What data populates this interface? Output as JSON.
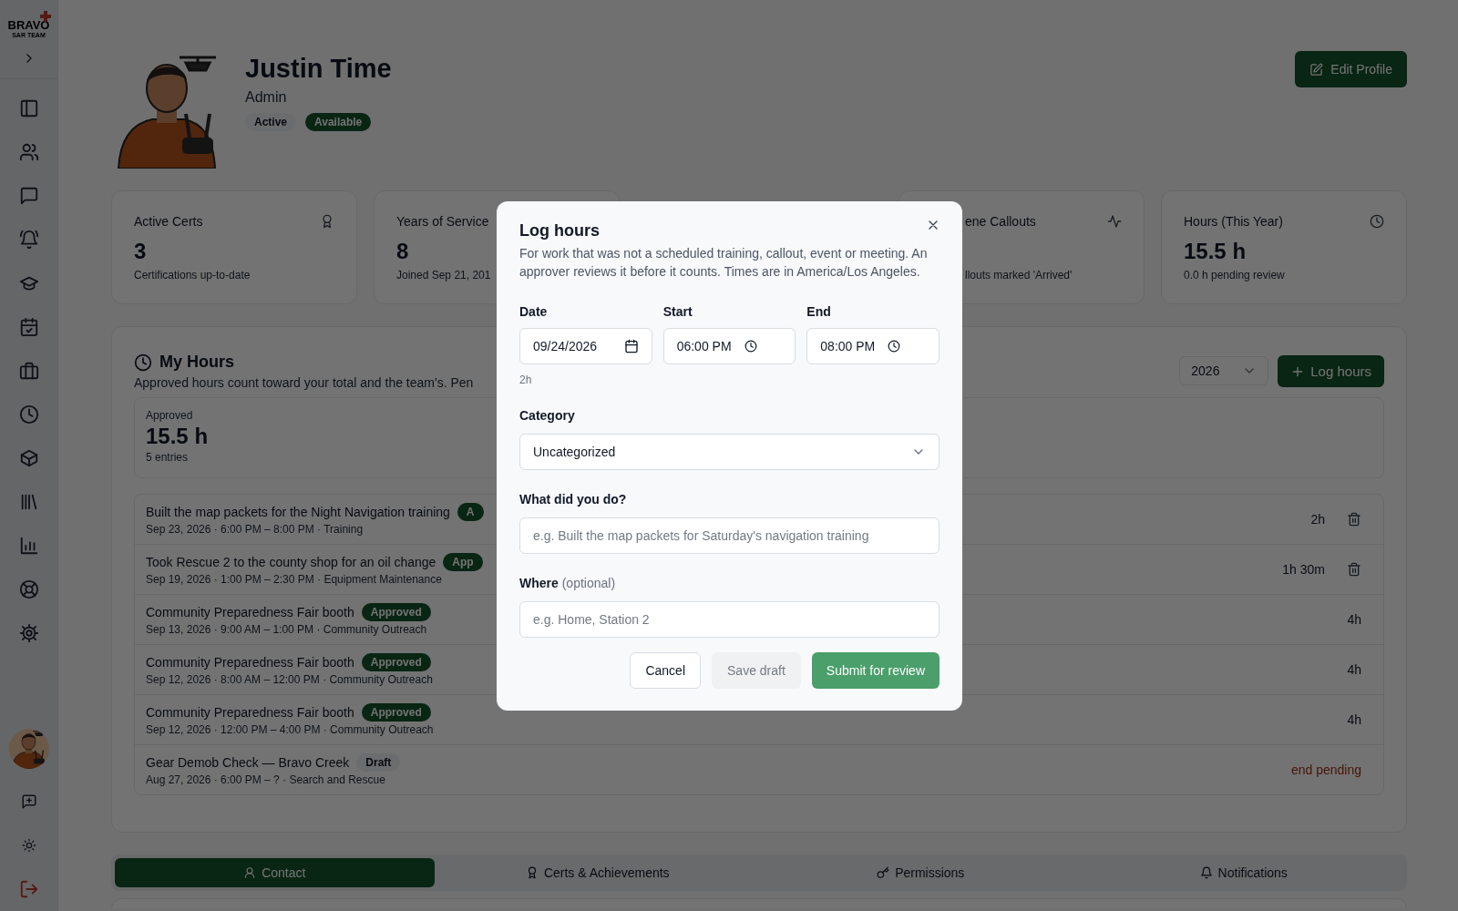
{
  "sidebar": {
    "logo": {
      "title": "BRAVO",
      "subtitle": "SAR TEAM"
    }
  },
  "profile": {
    "name": "Justin Time",
    "role": "Admin",
    "badges": [
      {
        "text": "Active",
        "kind": "neutral"
      },
      {
        "text": "Available",
        "kind": "success"
      }
    ],
    "edit_button": "Edit Profile"
  },
  "stats": [
    {
      "title": "Active Certs",
      "value": "3",
      "note": "Certifications up-to-date"
    },
    {
      "title": "Years of Service",
      "value": "8",
      "note": "Joined Sep 21, 201"
    },
    {
      "title": "ene Callouts",
      "note": "llouts marked 'Arrived'"
    },
    {
      "title": "Hours (This Year)",
      "value": "15.5 h",
      "note": "0.0 h pending review"
    }
  ],
  "my_hours": {
    "title": "My Hours",
    "description": "Approved hours count toward your total and the team's. Pen",
    "year": "2026",
    "log_button": "Log hours",
    "summary": {
      "label": "Approved",
      "value": "15.5 h",
      "note": "5 entries"
    },
    "entries": [
      {
        "title": "Built the map packets for the Night Navigation training",
        "badge": {
          "text": "A",
          "kind": "approved"
        },
        "meta": "Sep 23, 2026 · 6:00 PM – 8:00 PM · Training",
        "duration": "2h",
        "pending": false,
        "deletable": true
      },
      {
        "title": "Took Rescue 2 to the county shop for an oil change",
        "badge": {
          "text": "App",
          "kind": "approved"
        },
        "meta": "Sep 19, 2026 · 1:00 PM – 2:30 PM · Equipment Maintenance",
        "duration": "1h 30m",
        "pending": false,
        "deletable": true
      },
      {
        "title": "Community Preparedness Fair booth",
        "badge": {
          "text": "Approved",
          "kind": "approved"
        },
        "meta": "Sep 13, 2026 · 9:00 AM – 1:00 PM · Community Outreach",
        "duration": "4h",
        "pending": false,
        "deletable": false
      },
      {
        "title": "Community Preparedness Fair booth",
        "badge": {
          "text": "Approved",
          "kind": "approved"
        },
        "meta": "Sep 12, 2026 · 8:00 AM – 12:00 PM · Community Outreach",
        "duration": "4h",
        "pending": false,
        "deletable": false
      },
      {
        "title": "Community Preparedness Fair booth",
        "badge": {
          "text": "Approved",
          "kind": "approved"
        },
        "meta": "Sep 12, 2026 · 12:00 PM – 4:00 PM · Community Outreach",
        "duration": "4h",
        "pending": false,
        "deletable": false
      },
      {
        "title": "Gear Demob Check — Bravo Creek",
        "badge": {
          "text": "Draft",
          "kind": "draft"
        },
        "meta": "Aug 27, 2026 · 6:00 PM – ? · Search and Rescue",
        "duration": "end pending",
        "pending": true,
        "deletable": false
      }
    ]
  },
  "tabs": [
    {
      "label": "Contact",
      "selected": true
    },
    {
      "label": "Certs & Achievements",
      "selected": false
    },
    {
      "label": "Permissions",
      "selected": false
    },
    {
      "label": "Notifications",
      "selected": false
    }
  ],
  "dialog": {
    "title": "Log hours",
    "description": "For work that was not a scheduled training, callout, event or meeting. An approver reviews it before it counts. Times are in America/Los Angeles.",
    "date": {
      "label": "Date",
      "value": "09/24/2026"
    },
    "start": {
      "label": "Start",
      "value": "06:00 PM"
    },
    "end": {
      "label": "End",
      "value": "08:00 PM"
    },
    "duration": "2h",
    "category": {
      "label": "Category",
      "value": "Uncategorized"
    },
    "what": {
      "label": "What did you do?",
      "placeholder": "e.g. Built the map packets for Saturday's navigation training"
    },
    "where": {
      "label": "Where",
      "hint": "(optional)",
      "placeholder": "e.g. Home, Station 2"
    },
    "buttons": [
      {
        "label": "Cancel",
        "kind": "outline",
        "disabled": false
      },
      {
        "label": "Save draft",
        "kind": "ghost",
        "disabled": true
      },
      {
        "label": "Submit for review",
        "kind": "primary",
        "disabled": true
      }
    ]
  }
}
